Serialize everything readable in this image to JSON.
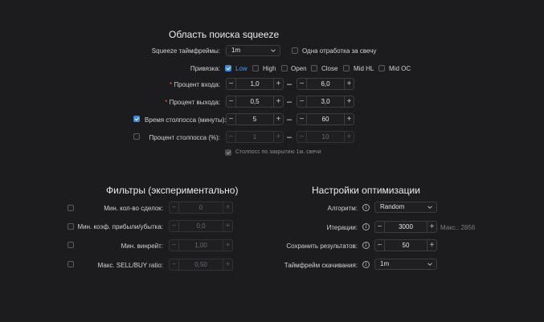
{
  "squeeze": {
    "title": "Область поиска squeeze",
    "timeframes_label": "Squeeze таймфреймы:",
    "timeframe_value": "1m",
    "single_candle_label": "Одна отработка за свечу",
    "binding_label": "Привязка:",
    "binding_options": [
      {
        "label": "Low",
        "checked": true
      },
      {
        "label": "High",
        "checked": false
      },
      {
        "label": "Open",
        "checked": false
      },
      {
        "label": "Close",
        "checked": false
      },
      {
        "label": "Mid HL",
        "checked": false
      },
      {
        "label": "Mid OC",
        "checked": false
      }
    ],
    "entry_label": "Процент входа:",
    "entry_min": "1,0",
    "entry_max": "6,0",
    "exit_label": "Процент выхода:",
    "exit_min": "0,5",
    "exit_max": "3,0",
    "stoploss_time_label": "Время столпосса (минуты):",
    "stoploss_time_min": "5",
    "stoploss_time_max": "60",
    "stoploss_pct_label": "Процент столпосса (%):",
    "stoploss_pct_min": "1",
    "stoploss_pct_max": "10",
    "stoploss_close_label": "Столпосс по закрытию 1м. свечи",
    "required_mark": "*",
    "dash": "–",
    "minus": "−",
    "plus": "+"
  },
  "filters": {
    "title": "Фильтры (экспериментально)",
    "rows": [
      {
        "label": "Мин. кол-во сделок:",
        "value": "0"
      },
      {
        "label": "Мин. коэф. прибыли/убытка:",
        "value": "0,0"
      },
      {
        "label": "Мин. винрейт:",
        "value": "1,00"
      },
      {
        "label": "Макс. SELL/BUY ratio:",
        "value": "0,50"
      }
    ]
  },
  "optimization": {
    "title": "Настройки оптимизации",
    "algorithm_label": "Алгоритм:",
    "algorithm_value": "Random",
    "iterations_label": "Итерации:",
    "iterations_value": "3000",
    "iterations_max": "Макс.: 2856",
    "save_results_label": "Сохранить результатов:",
    "save_results_value": "50",
    "download_tf_label": "Таймфрейм скачивания:",
    "download_tf_value": "1m",
    "info_glyph": "i"
  },
  "colors": {
    "accent": "#3b8de0",
    "background": "#1c1c1e",
    "required": "#e05a5a"
  }
}
